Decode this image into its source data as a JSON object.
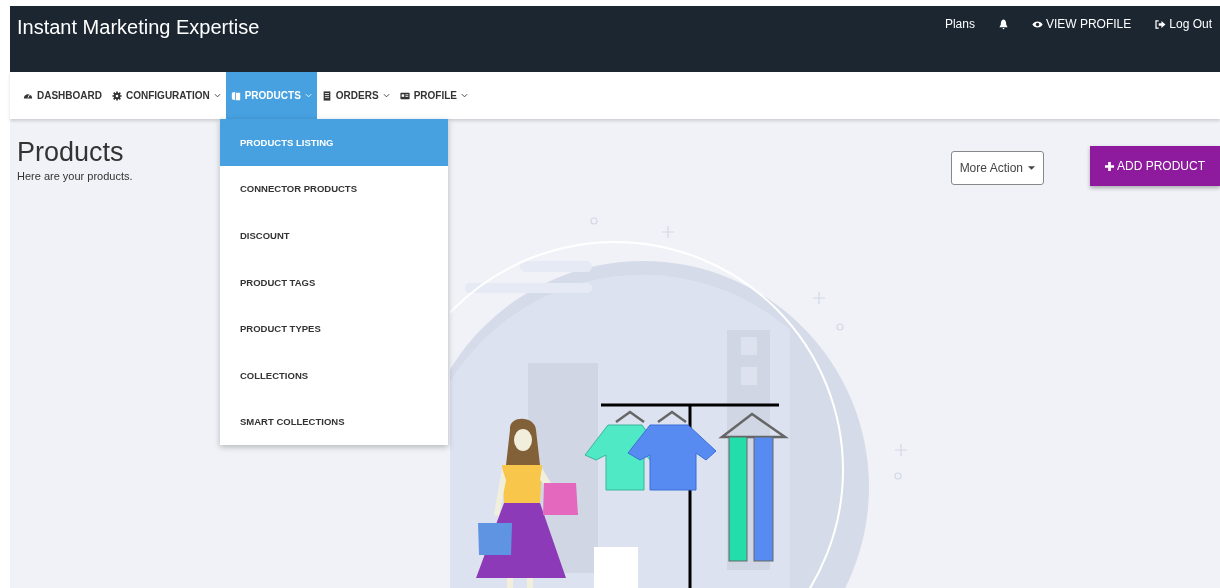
{
  "header": {
    "title": "Instant Marketing Expertise",
    "links": [
      {
        "kind": "text",
        "label": "Plans"
      },
      {
        "kind": "bell"
      },
      {
        "kind": "eye",
        "label": "VIEW PROFILE"
      },
      {
        "kind": "logout",
        "label": "Log Out"
      }
    ]
  },
  "nav": {
    "items": [
      {
        "label": "DASHBOARD",
        "caret": false,
        "selected": false
      },
      {
        "label": "CONFIGURATION",
        "caret": true,
        "selected": false
      },
      {
        "label": "PRODUCTS",
        "caret": true,
        "selected": true
      },
      {
        "label": "ORDERS",
        "caret": true,
        "selected": false
      },
      {
        "label": "PROFILE",
        "caret": true,
        "selected": false
      }
    ]
  },
  "dropdown": {
    "items": [
      {
        "label": "PRODUCTS LISTING",
        "selected": true
      },
      {
        "label": "CONNECTOR PRODUCTS",
        "selected": false
      },
      {
        "label": "DISCOUNT",
        "selected": false
      },
      {
        "label": "PRODUCT TAGS",
        "selected": false
      },
      {
        "label": "PRODUCT TYPES",
        "selected": false
      },
      {
        "label": "COLLECTIONS",
        "selected": false
      },
      {
        "label": "SMART COLLECTIONS",
        "selected": false
      }
    ]
  },
  "page": {
    "title": "Products",
    "subtitle": "Here are your products.",
    "more_action": "More Action",
    "add_button": "ADD PRODUCT"
  }
}
